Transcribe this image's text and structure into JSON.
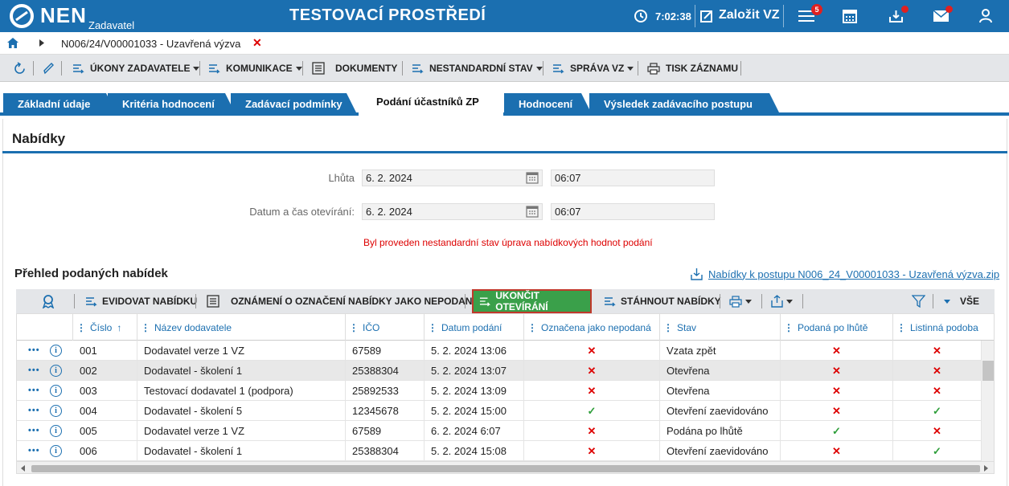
{
  "app": {
    "logo": "NEN",
    "role": "Zadavatel",
    "environment_title": "TESTOVACÍ PROSTŘEDÍ",
    "clock": "7:02:38",
    "create_label": "Založit VZ",
    "menu_badge": "5"
  },
  "breadcrumb": {
    "text": "N006/24/V00001033 - Uzavřená výzva",
    "close": "✕"
  },
  "toolbar": {
    "ukony": "ÚKONY ZADAVATELE",
    "komunikace": "KOMUNIKACE",
    "dokumenty": "DOKUMENTY",
    "nestandardni": "NESTANDARDNÍ STAV",
    "sprava": "SPRÁVA VZ",
    "tisk": "TISK ZÁZNAMU"
  },
  "tabs": [
    {
      "label": "Základní údaje"
    },
    {
      "label": "Kritéria hodnocení"
    },
    {
      "label": "Zadávací podmínky"
    },
    {
      "label": "Podání účastníků ZP"
    },
    {
      "label": "Hodnocení"
    },
    {
      "label": "Výsledek zadávacího postupu"
    }
  ],
  "section": {
    "title": "Nabídky",
    "lhuta_label": "Lhůta",
    "lhuta_date": "6. 2. 2024",
    "lhuta_time": "06:07",
    "otevirani_label": "Datum a čas otevírání:",
    "otevirani_date": "6. 2. 2024",
    "otevirani_time": "06:07",
    "notice": "Byl proveden nestandardní stav úprava nabídkových hodnot podání"
  },
  "overview": {
    "title": "Přehled podaných nabídek",
    "download_link": "Nabídky k postupu N006_24_V00001033 - Uzavřená výzva.zip"
  },
  "grid_toolbar": {
    "evidovat": "EVIDOVAT NABÍDKU",
    "oznameni": "OZNÁMENÍ O OZNAČENÍ NABÍDKY JAKO NEPODANÉ",
    "ukoncit": "UKONČIT OTEVÍRÁNÍ",
    "stahnout": "STÁHNOUT NABÍDKY",
    "vse": "VŠE"
  },
  "grid": {
    "headers": {
      "cislo": "Číslo",
      "nazev": "Název dodavatele",
      "ico": "IČO",
      "datum": "Datum podání",
      "nepodana": "Označena jako nepodaná",
      "stav": "Stav",
      "po_lhute": "Podaná po lhůtě",
      "listinna": "Listinná podoba"
    },
    "rows": [
      {
        "cislo": "001",
        "nazev": "Dodavatel verze 1 VZ",
        "ico": "67589",
        "datum": "5. 2. 2024 13:06",
        "nepodana": "✕",
        "stav": "Vzata zpět",
        "po_lhute": "✕",
        "listinna": "✕"
      },
      {
        "cislo": "002",
        "nazev": "Dodavatel - školení 1",
        "ico": "25388304",
        "datum": "5. 2. 2024 13:07",
        "nepodana": "✕",
        "stav": "Otevřena",
        "po_lhute": "✕",
        "listinna": "✕"
      },
      {
        "cislo": "003",
        "nazev": "Testovací dodavatel 1 (podpora)",
        "ico": "25892533",
        "datum": "5. 2. 2024 13:09",
        "nepodana": "✕",
        "stav": "Otevřena",
        "po_lhute": "✕",
        "listinna": "✕"
      },
      {
        "cislo": "004",
        "nazev": "Dodavatel - školení 5",
        "ico": "12345678",
        "datum": "5. 2. 2024 15:00",
        "nepodana": "✓",
        "stav": "Otevření zaevidováno",
        "po_lhute": "✕",
        "listinna": "✓"
      },
      {
        "cislo": "005",
        "nazev": "Dodavatel verze 1 VZ",
        "ico": "67589",
        "datum": "6. 2. 2024 6:07",
        "nepodana": "✕",
        "stav": "Podána po lhůtě",
        "po_lhute": "✓",
        "listinna": "✕"
      },
      {
        "cislo": "006",
        "nazev": "Dodavatel - školení 1",
        "ico": "25388304",
        "datum": "5. 2. 2024 15:08",
        "nepodana": "✕",
        "stav": "Otevření zaevidováno",
        "po_lhute": "✕",
        "listinna": "✓"
      }
    ]
  },
  "colors": {
    "primary": "#1b6fb0",
    "accent_green": "#3aa04a",
    "error_red": "#d00000"
  }
}
